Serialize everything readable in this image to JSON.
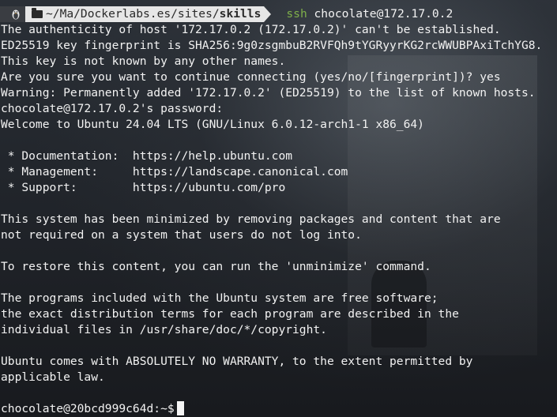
{
  "prompt": {
    "os_icon": "penguin-icon",
    "directory_prefix": "~/Ma/Dockerlabs.es/sites/",
    "directory_current": "skills",
    "command_word": "ssh",
    "command_args": " chocolate@172.17.0.2"
  },
  "output_lines": [
    "The authenticity of host '172.17.0.2 (172.17.0.2)' can't be established.",
    "ED25519 key fingerprint is SHA256:9g0zsgmbuB2RVFQh9tYGRyyrKG2rcWWUBPAxiTchYG8.",
    "This key is not known by any other names.",
    "Are you sure you want to continue connecting (yes/no/[fingerprint])? yes",
    "Warning: Permanently added '172.17.0.2' (ED25519) to the list of known hosts.",
    "chocolate@172.17.0.2's password:",
    "Welcome to Ubuntu 24.04 LTS (GNU/Linux 6.0.12-arch1-1 x86_64)",
    "",
    " * Documentation:  https://help.ubuntu.com",
    " * Management:     https://landscape.canonical.com",
    " * Support:        https://ubuntu.com/pro",
    "",
    "This system has been minimized by removing packages and content that are",
    "not required on a system that users do not log into.",
    "",
    "To restore this content, you can run the 'unminimize' command.",
    "",
    "The programs included with the Ubuntu system are free software;",
    "the exact distribution terms for each program are described in the",
    "individual files in /usr/share/doc/*/copyright.",
    "",
    "Ubuntu comes with ABSOLUTELY NO WARRANTY, to the extent permitted by",
    "applicable law.",
    ""
  ],
  "final_prompt": "chocolate@20bcd999c64d:~$"
}
